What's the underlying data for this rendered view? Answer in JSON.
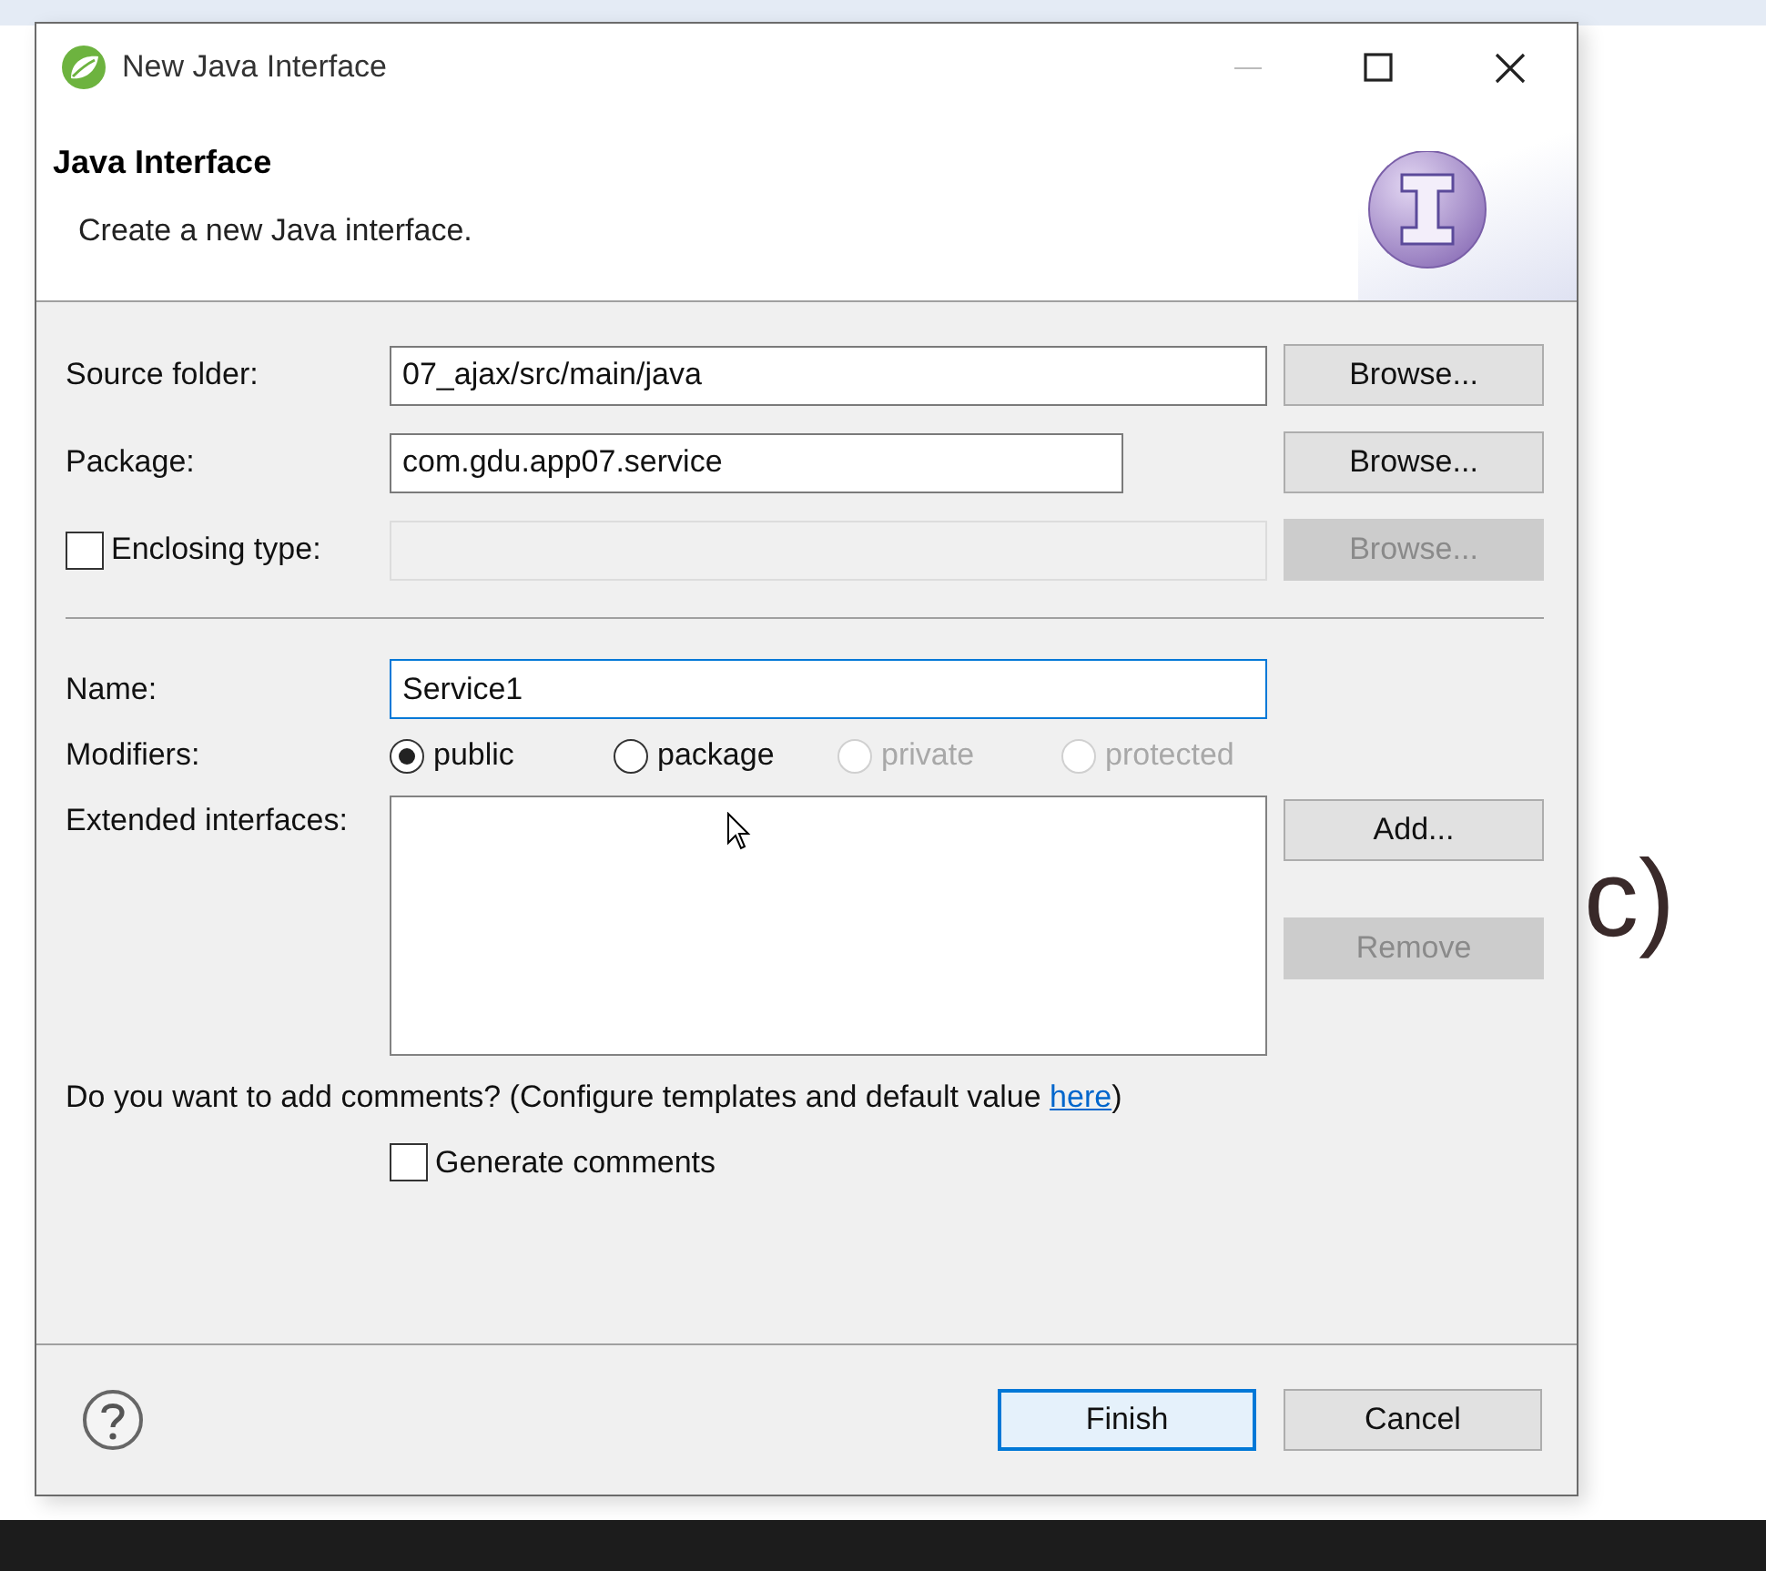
{
  "background_fragments": [
    {
      "text": "c)",
      "color": "#3a2a2a"
    }
  ],
  "window": {
    "title": "New Java Interface"
  },
  "header": {
    "title": "Java Interface",
    "description": "Create a new Java interface."
  },
  "location_rows": [
    {
      "kind": "text",
      "label": "Source folder:",
      "value": "07_ajax/src/main/java",
      "disabled": false,
      "button": {
        "label": "Browse...",
        "disabled": false
      }
    },
    {
      "kind": "text",
      "label": "Package:",
      "value": "com.gdu.app07.service",
      "disabled": false,
      "button": {
        "label": "Browse...",
        "disabled": false
      }
    },
    {
      "kind": "checkbox",
      "label": "Enclosing type:",
      "checked": false,
      "disabled": true,
      "button": {
        "label": "Browse...",
        "disabled": true
      }
    }
  ],
  "name": {
    "label": "Name:",
    "value": "Service1",
    "focused": true
  },
  "modifiers": {
    "label": "Modifiers:",
    "options": [
      {
        "label": "public",
        "selected": true,
        "disabled": false
      },
      {
        "label": "package",
        "selected": false,
        "disabled": false
      },
      {
        "label": "private",
        "selected": false,
        "disabled": true
      },
      {
        "label": "protected",
        "selected": false,
        "disabled": true
      }
    ]
  },
  "extended_interfaces": {
    "label": "Extended interfaces:",
    "buttons": [
      {
        "label": "Add...",
        "disabled": false
      },
      {
        "label": "Remove",
        "disabled": true
      }
    ]
  },
  "comments": {
    "prompt": "Do you want to add comments? (Configure templates and default value ",
    "link": "here",
    "suffix": ")",
    "generate": {
      "label": "Generate comments",
      "checked": false
    }
  },
  "footer_buttons": [
    {
      "label": "Finish",
      "default": true
    },
    {
      "label": "Cancel",
      "default": false
    }
  ]
}
